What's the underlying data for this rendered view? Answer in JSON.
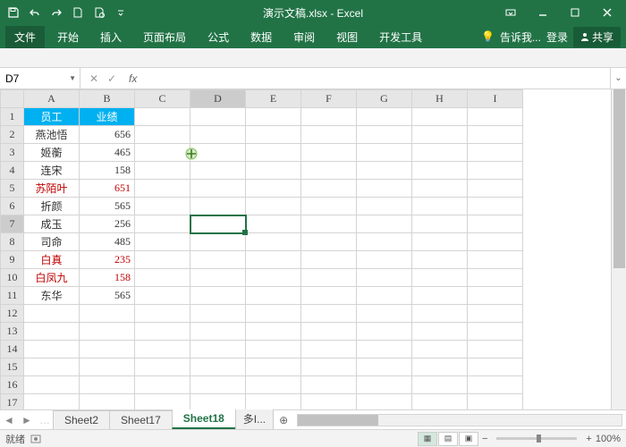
{
  "app": {
    "title": "演示文稿.xlsx - Excel"
  },
  "ribbon": {
    "file": "文件",
    "tabs": [
      "开始",
      "插入",
      "页面布局",
      "公式",
      "数据",
      "审阅",
      "视图",
      "开发工具"
    ],
    "tellme": "告诉我...",
    "login": "登录",
    "share": "共享"
  },
  "namebox": {
    "value": "D7"
  },
  "formula": {
    "value": ""
  },
  "columns": [
    "A",
    "B",
    "C",
    "D",
    "E",
    "F",
    "G",
    "H",
    "I"
  ],
  "rows": [
    "1",
    "2",
    "3",
    "4",
    "5",
    "6",
    "7",
    "8",
    "9",
    "10",
    "11",
    "12",
    "13",
    "14",
    "15",
    "16",
    "17"
  ],
  "active": {
    "row": 7,
    "col": "D",
    "header_col_idx": 3
  },
  "cells": {
    "headers": {
      "A": "员工",
      "B": "业绩"
    },
    "data": [
      {
        "name": "燕池悟",
        "val": "656",
        "red": false
      },
      {
        "name": "姬蘅",
        "val": "465",
        "red": false
      },
      {
        "name": "连宋",
        "val": "158",
        "red": false
      },
      {
        "name": "苏陌叶",
        "val": "651",
        "red": true
      },
      {
        "name": "折颜",
        "val": "565",
        "red": false
      },
      {
        "name": "成玉",
        "val": "256",
        "red": false
      },
      {
        "name": "司命",
        "val": "485",
        "red": false
      },
      {
        "name": "白真",
        "val": "235",
        "red": true
      },
      {
        "name": "白凤九",
        "val": "158",
        "red": true
      },
      {
        "name": "东华",
        "val": "565",
        "red": false
      }
    ]
  },
  "sheets": {
    "list": [
      "Sheet2",
      "Sheet17",
      "Sheet18",
      "多I..."
    ],
    "active": "Sheet18"
  },
  "status": {
    "ready": "就绪",
    "zoom_minus": "−",
    "zoom_plus": "+",
    "zoom": "100%"
  }
}
